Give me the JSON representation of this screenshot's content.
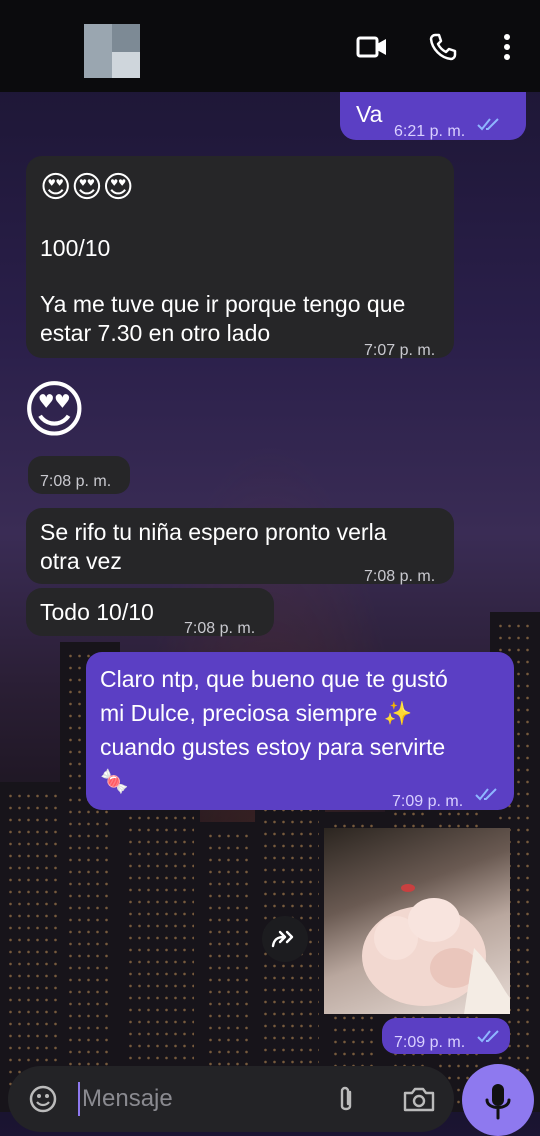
{
  "header": {
    "contact_name": "",
    "icons": [
      "video-call-icon",
      "phone-icon",
      "more-options-icon"
    ]
  },
  "messages": {
    "m1": {
      "text": "Va",
      "time": "6:21 p. m."
    },
    "m2": {
      "emojis": "😍😍😍",
      "line1": "100/10",
      "line2": "Ya me tuve que ir porque tengo que\nestar 7.30 en otro lado",
      "time": "7:07 p. m."
    },
    "m3": {
      "emoji": "😍",
      "time": "7:08 p. m."
    },
    "m4": {
      "text": "Se rifo tu niña espero pronto verla\notra vez",
      "time": "7:08 p. m."
    },
    "m5": {
      "text": "Todo 10/10",
      "time": "7:08 p. m."
    },
    "m6": {
      "text": "Claro ntp, que bueno que te gustó\nmi Dulce, preciosa siempre ✨\ncuando gustes estoy para servirte\n🍬",
      "time": "7:09 p. m."
    },
    "m7": {
      "time": "7:09 p. m."
    }
  },
  "input": {
    "placeholder": "Mensaje"
  },
  "colors": {
    "outgoing": "#5b3fc4",
    "incoming": "#262628",
    "mic": "#8e79ef",
    "read_ticks": "#8fb6ff"
  }
}
